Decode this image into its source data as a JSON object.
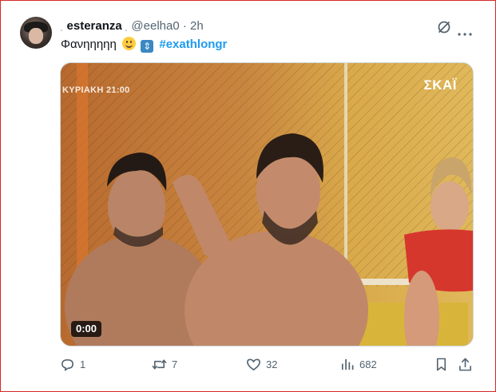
{
  "tweet": {
    "display_name": "esteranza",
    "name_decoration_left": "˛",
    "name_decoration_right": "˛",
    "handle": "@eelha0",
    "separator": "·",
    "time": "2h",
    "text": "Φανηηηηη",
    "emojis": [
      "slightly-smiling-face",
      "up-down-arrow"
    ],
    "hashtag": "#exathlongr"
  },
  "media": {
    "overlay_channel_text": "ΚΥΡΙΑΚΗ 21:00",
    "channel_logo": "ΣΚΑΪ",
    "duration": "0:00"
  },
  "actions": {
    "replies": "1",
    "retweets": "7",
    "likes": "32",
    "views": "682"
  },
  "colors": {
    "accent": "#1d9bf0",
    "secondary_text": "#536471",
    "frame_border": "#d62828"
  }
}
